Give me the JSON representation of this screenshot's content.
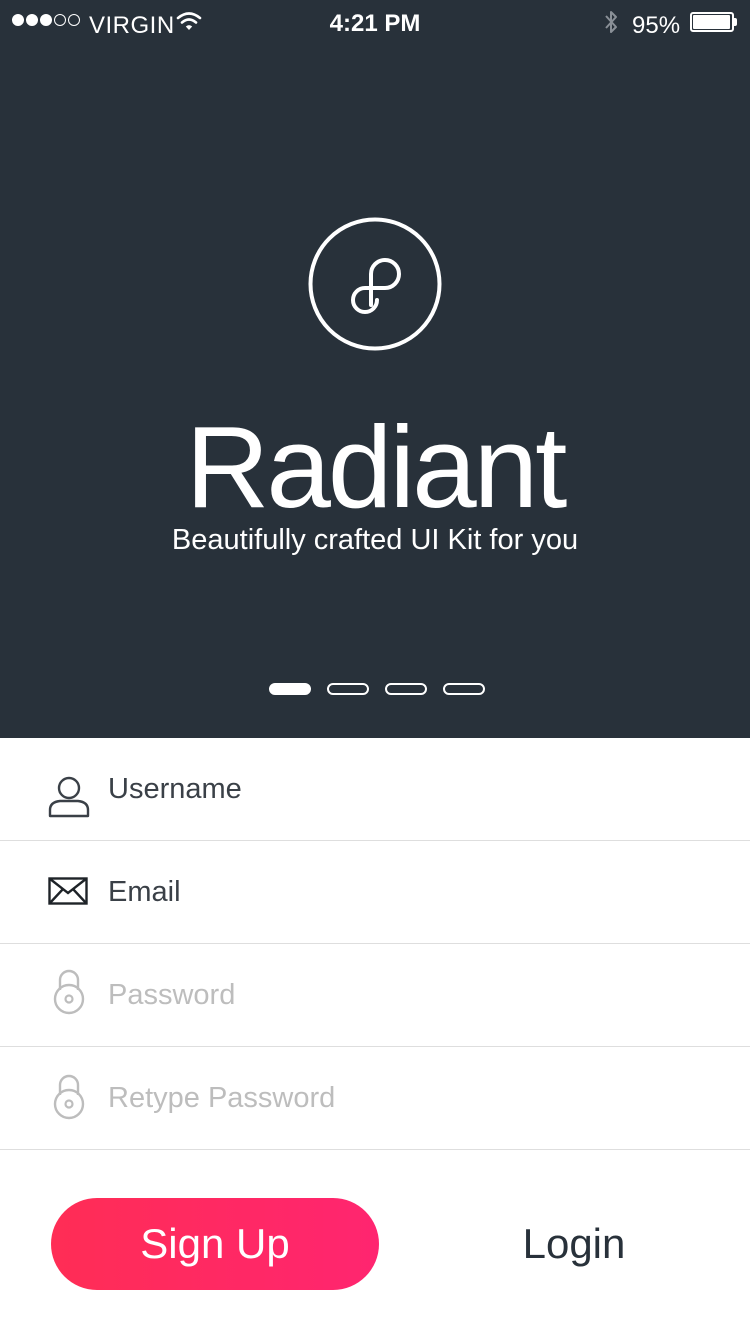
{
  "status_bar": {
    "carrier": "VIRGIN",
    "time": "4:21 PM",
    "battery": "95%",
    "signal_strength": 3,
    "signal_total": 5,
    "icons": [
      "wifi-icon",
      "bluetooth-icon",
      "battery-icon"
    ]
  },
  "hero": {
    "logo_icon": "radiant-logo-icon",
    "title": "Radiant",
    "tagline": "Beautifully crafted UI Kit for you",
    "pager": {
      "total": 4,
      "active_index": 0
    },
    "background": "#28313a"
  },
  "form": {
    "username": {
      "placeholder": "Username",
      "icon": "user-icon"
    },
    "email": {
      "placeholder": "Email",
      "icon": "mail-icon"
    },
    "password": {
      "placeholder": "Password",
      "icon": "lock-icon"
    },
    "retype_password": {
      "placeholder": "Retype Password",
      "icon": "lock-icon"
    }
  },
  "actions": {
    "signup_label": "Sign Up",
    "login_label": "Login",
    "accent": "#ff2d55"
  }
}
